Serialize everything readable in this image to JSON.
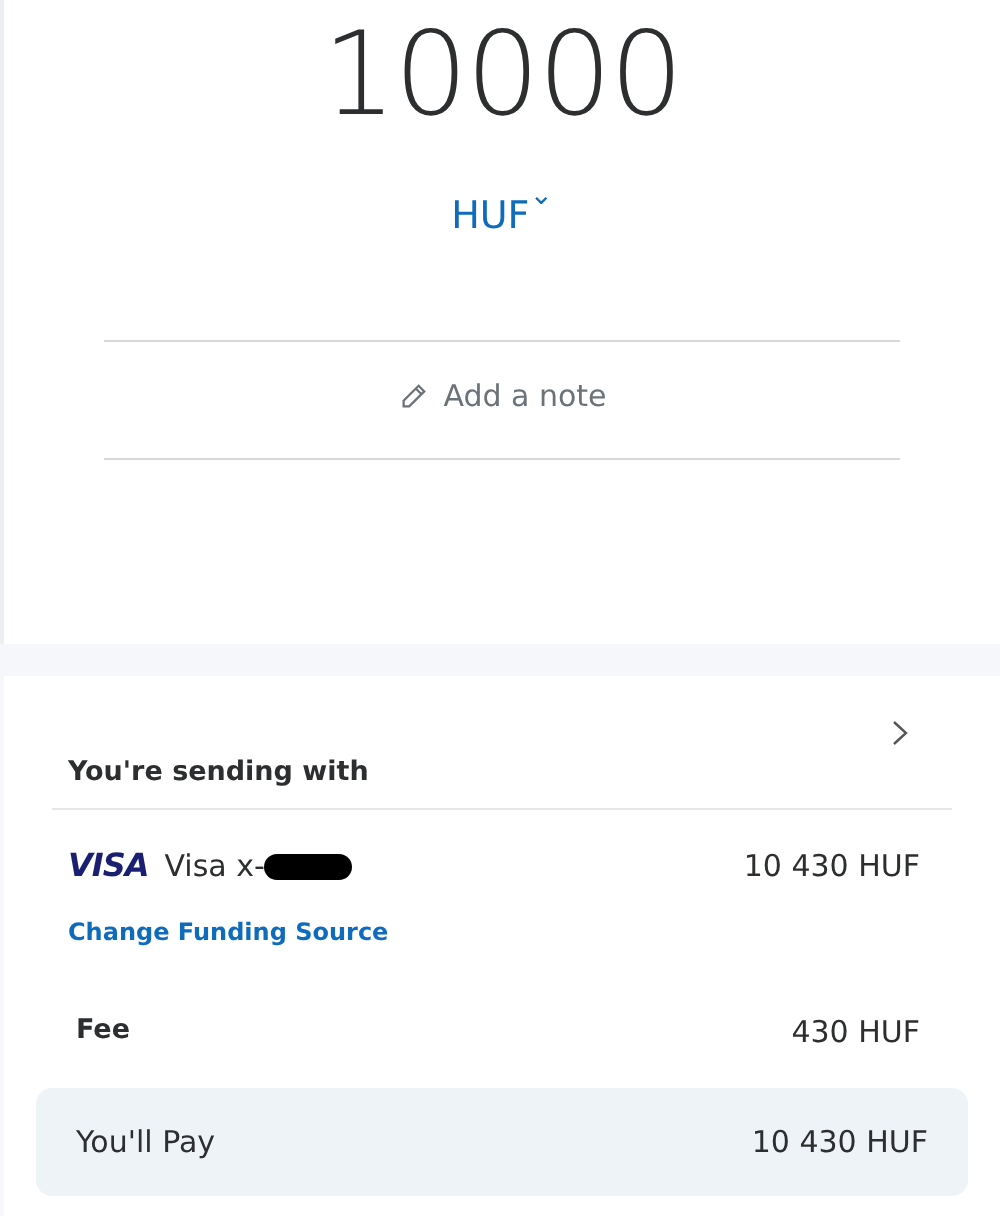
{
  "amount": "10000",
  "currency": {
    "code": "HUF",
    "dropdown_icon": "⌄"
  },
  "note": {
    "placeholder": "Add a note"
  },
  "funding": {
    "heading": "You're sending with",
    "card_brand": "VISA",
    "card_label": "Visa x-",
    "card_amount": "10 430 HUF",
    "change_link": "Change Funding Source"
  },
  "fee": {
    "label": "Fee",
    "value": "430 HUF"
  },
  "total": {
    "label": "You'll Pay",
    "value": "10 430 HUF"
  }
}
